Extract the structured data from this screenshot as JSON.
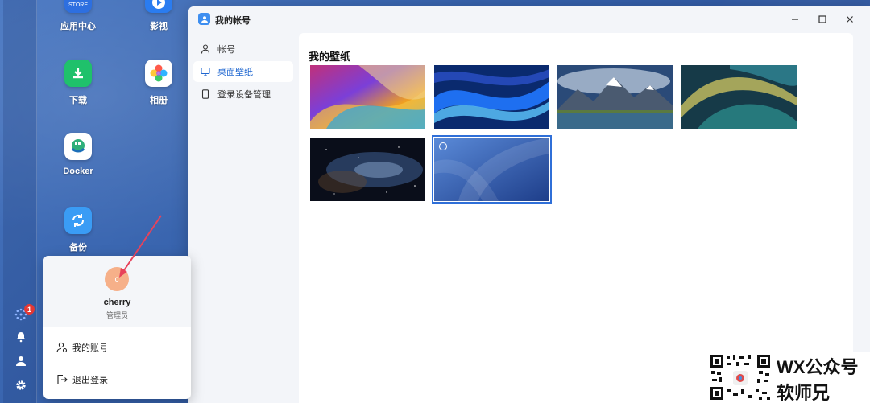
{
  "desktop": {
    "apps": [
      {
        "name": "app-center",
        "label": "应用中心",
        "tile_text": "STORE"
      },
      {
        "name": "video",
        "label": "影视"
      },
      {
        "name": "download",
        "label": "下载"
      },
      {
        "name": "photos",
        "label": "相册"
      },
      {
        "name": "docker",
        "label": "Docker"
      },
      {
        "name": "backup",
        "label": "备份"
      }
    ]
  },
  "dock": {
    "notification_count": "1",
    "icons": [
      "dots-grid-icon",
      "bell-icon",
      "user-icon",
      "gear-icon"
    ]
  },
  "window": {
    "title": "我的帐号",
    "sidebar": [
      {
        "label": "帐号",
        "icon": "user-icon",
        "active": false
      },
      {
        "label": "桌面壁纸",
        "icon": "monitor-icon",
        "active": true
      },
      {
        "label": "登录设备管理",
        "icon": "phone-icon",
        "active": false
      }
    ],
    "content_title": "我的壁纸",
    "wallpapers": [
      {
        "name": "rainbow-waves",
        "selected": false
      },
      {
        "name": "blue-ribbons",
        "selected": false
      },
      {
        "name": "mountain-lake",
        "selected": false
      },
      {
        "name": "green-swirl",
        "selected": false
      },
      {
        "name": "galaxy",
        "selected": false
      },
      {
        "name": "blue-abstract",
        "selected": true
      }
    ]
  },
  "user_popup": {
    "avatar_letter": "c",
    "username": "cherry",
    "role": "管理员",
    "menu": [
      {
        "label": "我的账号",
        "icon": "user-gear-icon"
      },
      {
        "label": "退出登录",
        "icon": "logout-icon"
      }
    ]
  },
  "watermark": {
    "line1": "WX公众号",
    "line2": "软师兄"
  },
  "colors": {
    "accent": "#1e66d0",
    "desktop": "#3560aa",
    "badge": "#e53935",
    "avatar": "#f6b089",
    "arrow": "#e8425a"
  }
}
